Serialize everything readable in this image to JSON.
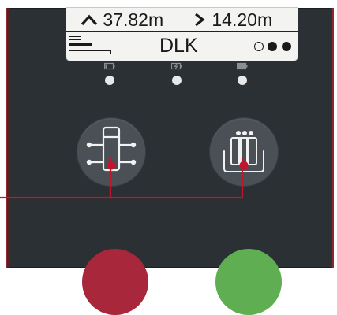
{
  "display": {
    "up_distance": "37.82m",
    "right_distance": "14.20m",
    "mode": "DLK",
    "up_arrow": "⌃",
    "right_arrow": "›"
  },
  "indicators": [
    {
      "icon": "battery-low-icon",
      "state": "on"
    },
    {
      "icon": "charging-icon",
      "state": "on"
    },
    {
      "icon": "battery-full-icon",
      "state": "on"
    }
  ],
  "buttons": [
    {
      "name": "crane-button",
      "icon": "crane-hoist-icon"
    },
    {
      "name": "group-button",
      "icon": "group-crane-icon"
    }
  ],
  "colors": {
    "panel": "#2b3034",
    "accent_red": "#c0172c",
    "bottom_left": "#a8273a",
    "bottom_right": "#5fae52",
    "leader_line": "#c0172c"
  }
}
